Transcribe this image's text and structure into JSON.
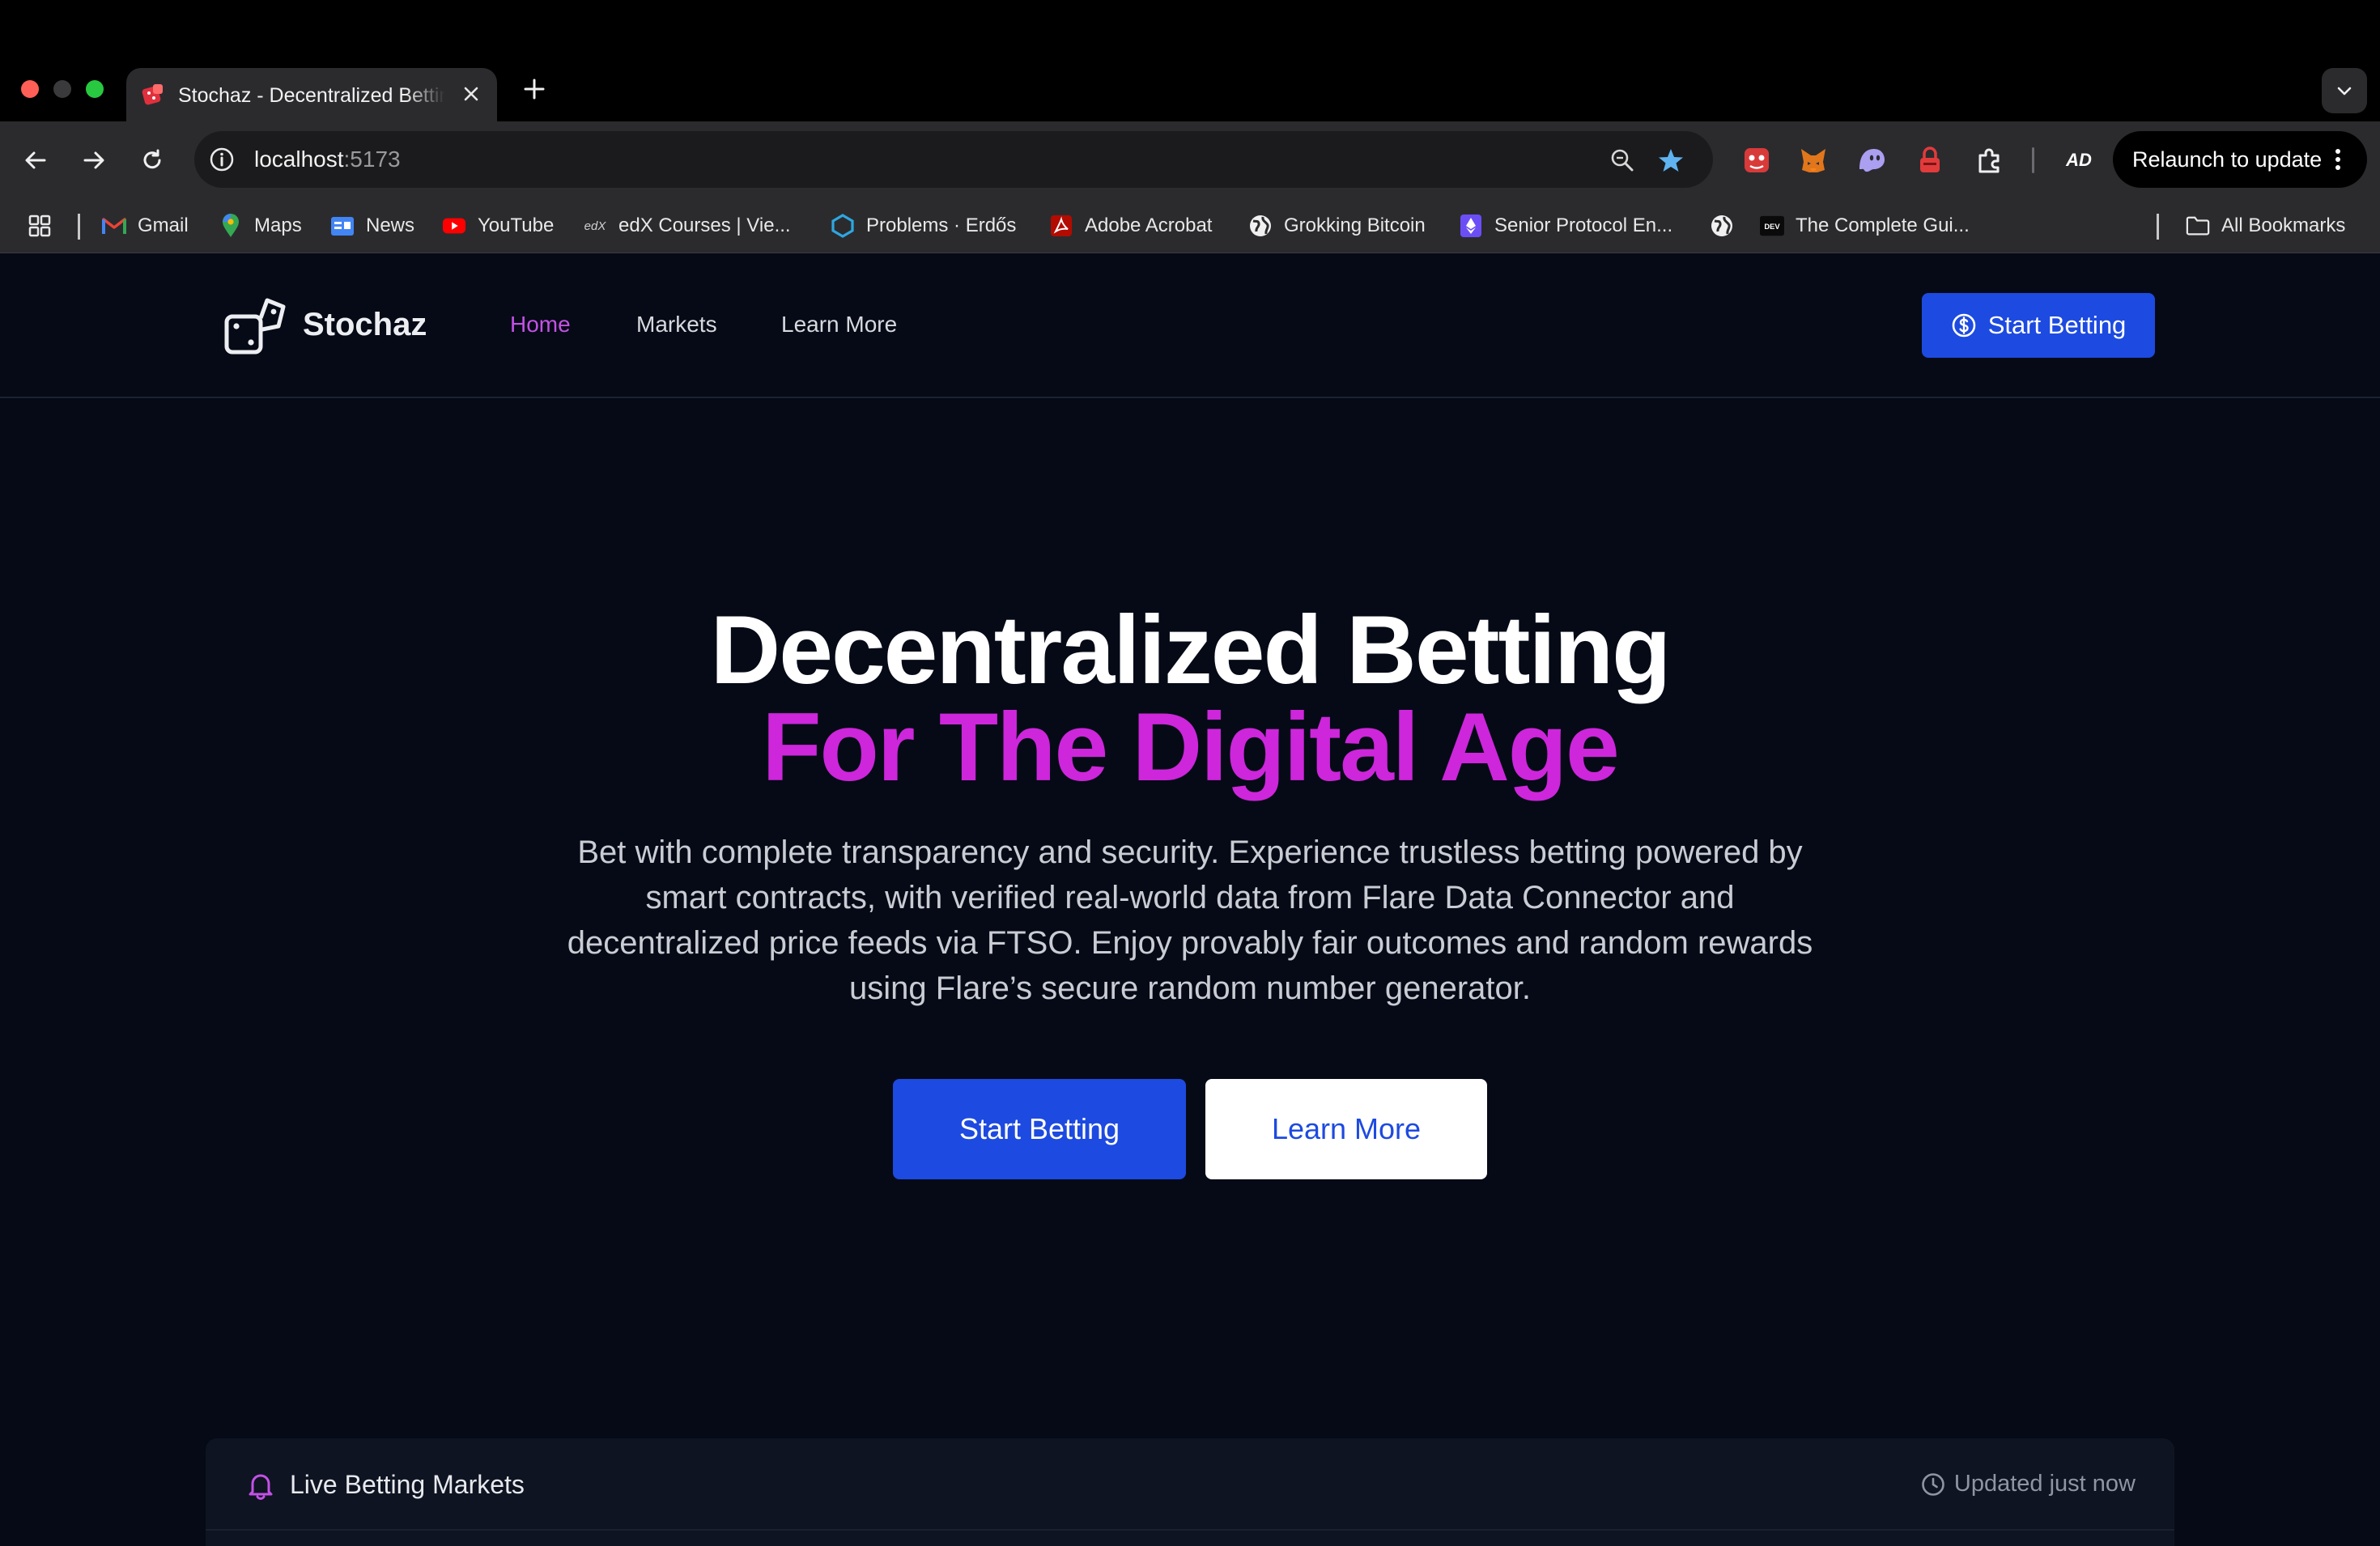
{
  "browser": {
    "tab": {
      "title": "Stochaz - Decentralized Betting"
    },
    "address": {
      "host": "localhost",
      "port": ":5173"
    },
    "relaunch_label": "Relaunch to update",
    "profile_initials": "AD",
    "bookmarks": [
      {
        "label": "Gmail",
        "icon": "gmail-icon"
      },
      {
        "label": "Maps",
        "icon": "maps-icon"
      },
      {
        "label": "News",
        "icon": "news-icon"
      },
      {
        "label": "YouTube",
        "icon": "youtube-icon"
      },
      {
        "label": "edX Courses | Vie...",
        "icon": "edx-icon"
      },
      {
        "label": "Problems · Erdős",
        "icon": "hexagon-icon"
      },
      {
        "label": "Adobe Acrobat",
        "icon": "acrobat-icon"
      },
      {
        "label": "Grokking Bitcoin",
        "icon": "globe-icon"
      },
      {
        "label": "Senior Protocol En...",
        "icon": "ethereum-icon"
      },
      {
        "label": "",
        "icon": "globe-icon"
      },
      {
        "label": "The Complete Gui...",
        "icon": "dev-icon"
      }
    ],
    "all_bookmarks_label": "All Bookmarks"
  },
  "site": {
    "brand": "Stochaz",
    "nav": [
      "Home",
      "Markets",
      "Learn More"
    ],
    "active_nav": "Home",
    "header_cta": "Start Betting"
  },
  "hero": {
    "title_line1": "Decentralized Betting",
    "title_line2": "For The Digital Age",
    "description": "Bet with complete transparency and security. Experience trustless betting powered by smart contracts, with verified real-world data from Flare Data Connector and decentralized price feeds via FTSO. Enjoy provably fair outcomes and random rewards using Flare’s secure random number generator.",
    "primary_button": "Start Betting",
    "secondary_button": "Learn More"
  },
  "markets": {
    "title": "Live Betting Markets",
    "updated": "Updated just now"
  },
  "colors": {
    "page_bg": "#050a16",
    "accent_purple": "#cd26db",
    "nav_active": "#c451e6",
    "primary_blue": "#1d4ae0",
    "chrome_bg": "#2b2b2e"
  }
}
